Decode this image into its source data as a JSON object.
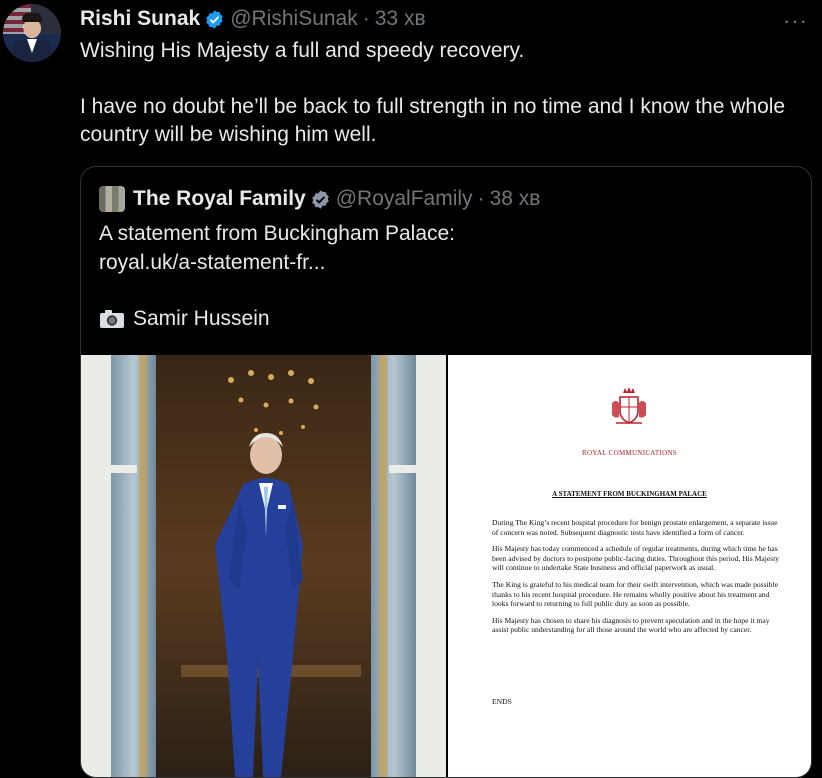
{
  "tweet": {
    "author_name": "Rishi Sunak",
    "author_handle": "@RishiSunak",
    "separator": "·",
    "time": "33 хв",
    "more_label": "···",
    "paragraphs": [
      "Wishing His Majesty a full and speedy recovery.",
      "I have no doubt he’ll be back to full strength in no time and I know the whole country will be wishing him well."
    ]
  },
  "quote": {
    "author_name": "The Royal Family",
    "author_handle": "@RoyalFamily",
    "separator": "·",
    "time": "38 хв",
    "text_line": "A statement from Buckingham Palace:",
    "link": "royal.uk/a-statement-fr...",
    "photo_credit": "Samir Hussein"
  },
  "letter": {
    "heading": "ROYAL COMMUNICATIONS",
    "title": "A STATEMENT FROM BUCKINGHAM PALACE",
    "paragraphs": [
      "During The King’s recent hospital procedure for benign prostate enlargement, a separate issue of concern was noted. Subsequent diagnostic tests have identified a form of cancer.",
      "His Majesty has today commenced a schedule of regular treatments, during which time he has been advised by doctors to postpone public-facing duties. Throughout this period, His Majesty will continue to undertake State business and official paperwork as usual.",
      "The King is grateful to his medical team for their swift intervention, which was made possible thanks to his recent hospital procedure. He remains wholly positive about his treatment and looks forward to returning to full public duty as soon as possible.",
      "His Majesty has chosen to share his diagnosis to prevent speculation and in the hope it may assist public understanding for all those around the world who are affected by cancer."
    ],
    "ends": "ENDS"
  },
  "colors": {
    "verified": "#1d9bf0",
    "crest": "#c0202b",
    "muted": "#71767b"
  },
  "icons": {
    "verified": "verified-badge-icon",
    "more": "more-options-icon",
    "camera": "camera-icon",
    "crest": "royal-crest-icon"
  }
}
